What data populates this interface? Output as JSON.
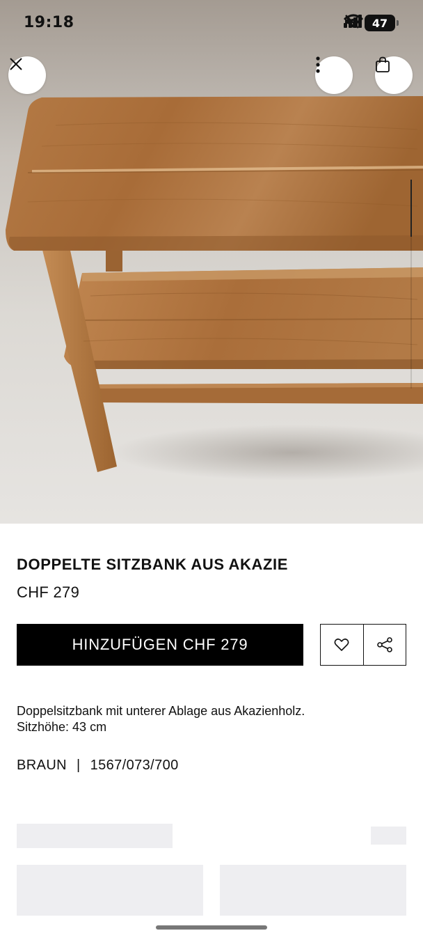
{
  "status_bar": {
    "time": "19:18",
    "battery": "47",
    "icons": [
      "mute-icon",
      "signal-icon",
      "wifi-icon",
      "battery-icon"
    ]
  },
  "header": {
    "close_icon": "close-icon",
    "more_icon": "more-vertical-icon",
    "bag_icon": "shopping-bag-icon"
  },
  "product": {
    "title": "DOPPELTE SITZBANK AUS AKAZIE",
    "price": "CHF 279",
    "add_label": "HINZUFÜGEN CHF 279",
    "description_line1": "Doppelsitzbank mit unterer Ablage aus Akazienholz.",
    "description_line2": "Sitzhöhe: 43 cm",
    "color": "BRAUN",
    "separator": "|",
    "ref": "1567/073/700"
  },
  "actions": {
    "favorite_icon": "heart-icon",
    "share_icon": "share-icon"
  },
  "colors": {
    "button_bg": "#000000",
    "placeholder": "#eeeef1",
    "wood": "#a86f3c"
  }
}
